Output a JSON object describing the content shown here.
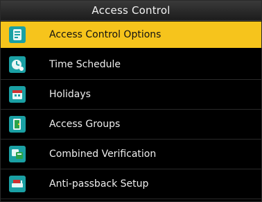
{
  "window": {
    "title": "Access Control"
  },
  "menu": {
    "items": [
      {
        "label": "Access Control Options",
        "icon": "access-control-options-icon",
        "selected": true
      },
      {
        "label": "Time Schedule",
        "icon": "time-schedule-icon",
        "selected": false
      },
      {
        "label": "Holidays",
        "icon": "holidays-icon",
        "selected": false
      },
      {
        "label": "Access Groups",
        "icon": "access-groups-icon",
        "selected": false
      },
      {
        "label": "Combined Verification",
        "icon": "combined-verification-icon",
        "selected": false
      },
      {
        "label": "Anti-passback Setup",
        "icon": "anti-passback-setup-icon",
        "selected": false
      }
    ]
  },
  "colors": {
    "background": "#000000",
    "highlight": "#f6c41c",
    "text": "#eeeeee",
    "icon_teal": "#1fa6a6"
  }
}
